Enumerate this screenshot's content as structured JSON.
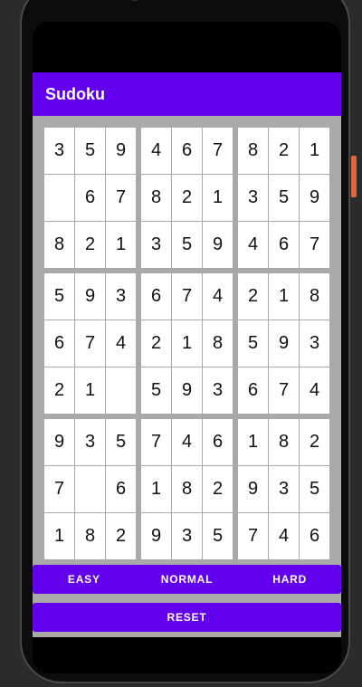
{
  "app": {
    "title": "Sudoku"
  },
  "colors": {
    "primary": "#6200ee",
    "board_background": "#a9a9a9",
    "cell_background": "#ffffff"
  },
  "board": {
    "blocks": [
      [
        "3",
        "5",
        "9",
        "",
        "6",
        "7",
        "8",
        "2",
        "1"
      ],
      [
        "4",
        "6",
        "7",
        "8",
        "2",
        "1",
        "3",
        "5",
        "9"
      ],
      [
        "8",
        "2",
        "1",
        "3",
        "5",
        "9",
        "4",
        "6",
        "7"
      ],
      [
        "5",
        "9",
        "3",
        "6",
        "7",
        "4",
        "2",
        "1",
        ""
      ],
      [
        "6",
        "7",
        "4",
        "2",
        "1",
        "8",
        "5",
        "9",
        "3"
      ],
      [
        "2",
        "1",
        "8",
        "5",
        "9",
        "3",
        "6",
        "7",
        "4"
      ],
      [
        "9",
        "3",
        "5",
        "7",
        "",
        "6",
        "1",
        "8",
        "2"
      ],
      [
        "7",
        "4",
        "6",
        "1",
        "8",
        "2",
        "9",
        "3",
        "5"
      ],
      [
        "1",
        "8",
        "2",
        "9",
        "3",
        "5",
        "7",
        "4",
        "6"
      ]
    ]
  },
  "difficulty": {
    "easy_label": "EASY",
    "normal_label": "NORMAL",
    "hard_label": "HARD"
  },
  "reset_label": "RESET"
}
